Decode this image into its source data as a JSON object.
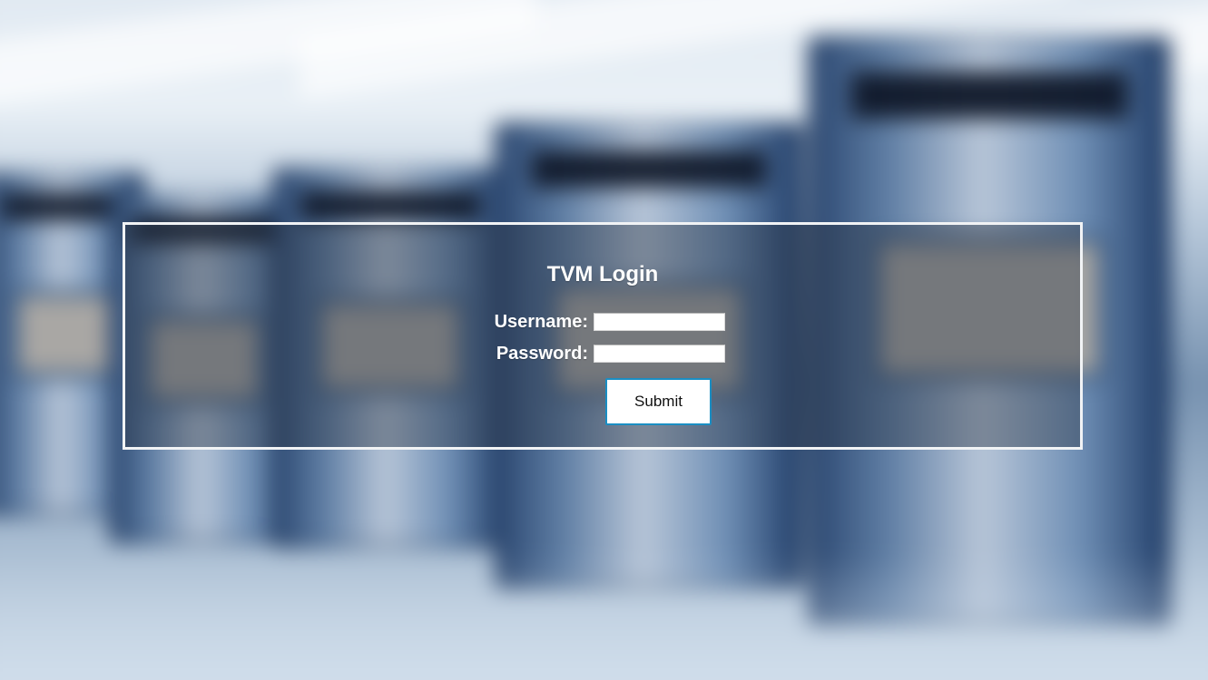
{
  "login": {
    "title": "TVM Login",
    "username_label": "Username:",
    "password_label": "Password:",
    "username_value": "",
    "password_value": "",
    "submit_label": "Submit"
  },
  "colors": {
    "panel_border": "#f1f3f5",
    "panel_overlay": "#2d3744",
    "button_border": "#1a8ec3",
    "text": "#ffffff"
  },
  "background": {
    "subject": "blurred ticket vending machines"
  }
}
